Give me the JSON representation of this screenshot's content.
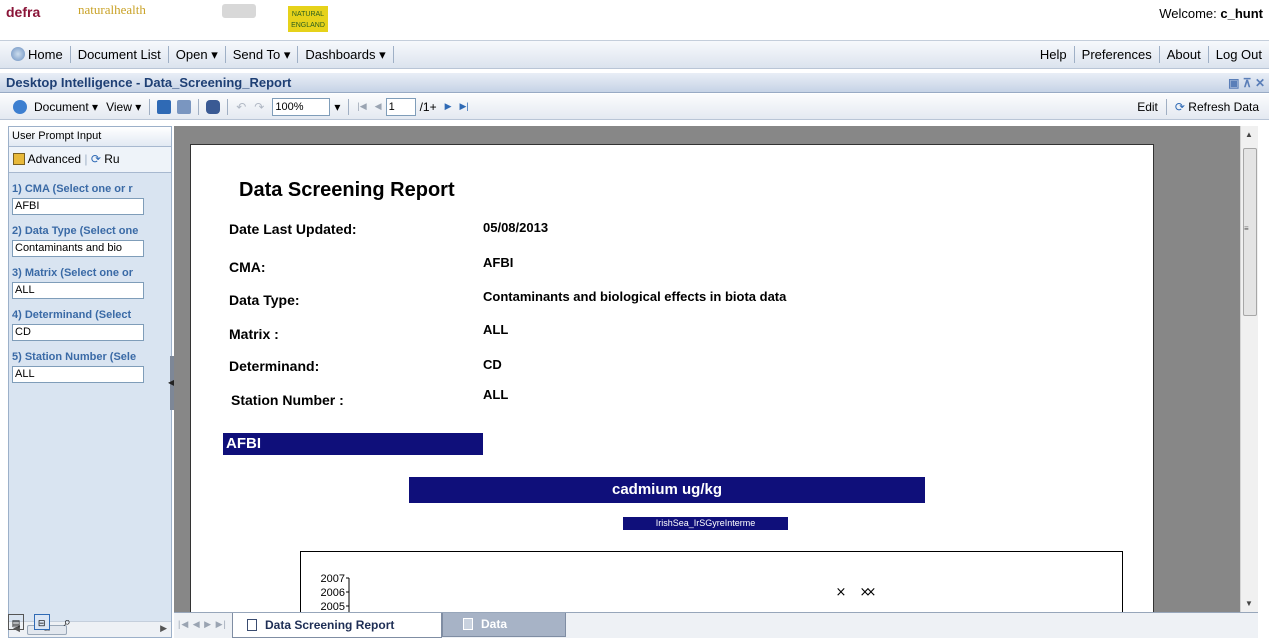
{
  "branding": {
    "defra": "defra",
    "partner": "naturalhealth",
    "natural_england": "NATURAL ENGLAND"
  },
  "welcome": {
    "prefix": "Welcome:",
    "user": "c_hunt"
  },
  "menu": {
    "home": "Home",
    "document_list": "Document List",
    "open": "Open",
    "send_to": "Send To",
    "dashboards": "Dashboards",
    "help": "Help",
    "preferences": "Preferences",
    "about": "About",
    "logout": "Log Out"
  },
  "window_title": "Desktop Intelligence - Data_Screening_Report",
  "toolbar": {
    "document": "Document",
    "view": "View",
    "zoom": "100%",
    "page": "1",
    "page_total": "/1+",
    "edit": "Edit",
    "refresh": "Refresh Data"
  },
  "left_panel": {
    "title": "User Prompt Input",
    "advanced": "Advanced",
    "run": "Ru",
    "prompts": [
      {
        "label": "1) CMA (Select one or r",
        "value": "AFBI"
      },
      {
        "label": "2) Data Type (Select one",
        "value": "Contaminants and bio"
      },
      {
        "label": "3) Matrix (Select one or",
        "value": "ALL"
      },
      {
        "label": "4) Determinand (Select",
        "value": "CD"
      },
      {
        "label": "5) Station Number (Sele",
        "value": "ALL"
      }
    ]
  },
  "report": {
    "title": "Data Screening Report",
    "fields": [
      {
        "label": "Date Last Updated:",
        "value": "05/08/2013"
      },
      {
        "label": "CMA:",
        "value": "AFBI"
      },
      {
        "label": "Data Type:",
        "value": "Contaminants and biological effects in biota data"
      },
      {
        "label": "Matrix :",
        "value": "ALL"
      },
      {
        "label": "Determinand:",
        "value": "CD"
      },
      {
        "label": "Station Number :",
        "value": "ALL"
      }
    ],
    "section": "AFBI",
    "chart_title": "cadmium  ug/kg",
    "series_tag": "IrishSea_IrSGyreInterme"
  },
  "chart_data": {
    "type": "scatter",
    "title": "cadmium  ug/kg",
    "y_tick_labels": [
      "2007",
      "2006",
      "2005"
    ],
    "markers": "×",
    "points_visible": 3
  },
  "tabs": [
    {
      "label": "Data Screening Report",
      "active": true
    },
    {
      "label": "Data",
      "active": false
    }
  ],
  "colors": {
    "report_header": "#0f0f7a",
    "viewer_bg": "#878787",
    "prompt_label": "#3a6aa6"
  }
}
